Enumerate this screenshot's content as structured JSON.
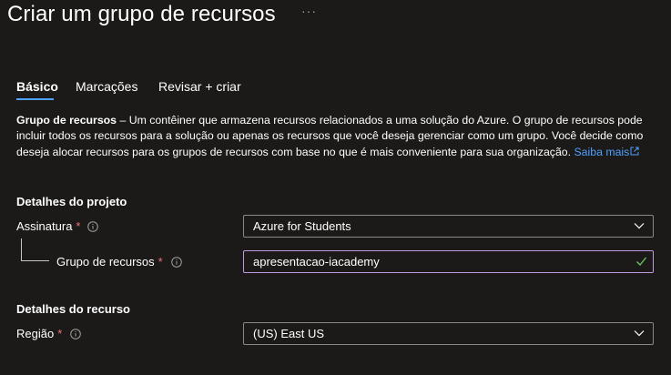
{
  "header": {
    "title": "Criar um grupo de recursos",
    "more_label": "···"
  },
  "tabs": [
    {
      "label": "Básico",
      "active": true
    },
    {
      "label": "Marcações",
      "active": false
    },
    {
      "label": "Revisar + criar",
      "active": false
    }
  ],
  "description": {
    "bold": "Grupo de recursos",
    "text": " – Um contêiner que armazena recursos relacionados a uma solução do Azure. O grupo de recursos pode incluir todos os recursos para a solução ou apenas os recursos que você deseja gerenciar como um grupo. Você decide como deseja alocar recursos para os grupos de recursos com base no que é mais conveniente para sua organização. ",
    "link": "Saiba mais"
  },
  "project_details": {
    "title": "Detalhes do projeto",
    "subscription": {
      "label": "Assinatura",
      "required": "*",
      "value": "Azure for Students"
    },
    "resource_group": {
      "label": "Grupo de recursos",
      "required": "*",
      "value": "apresentacao-iacademy"
    }
  },
  "resource_details": {
    "title": "Detalhes do recurso",
    "region": {
      "label": "Região",
      "required": "*",
      "value": "(US) East US"
    }
  },
  "colors": {
    "background": "#1b1a19",
    "link": "#4fa1ff",
    "required": "#f1707b",
    "focus_border": "#c19ae0",
    "valid_check": "#6ccb5f"
  }
}
